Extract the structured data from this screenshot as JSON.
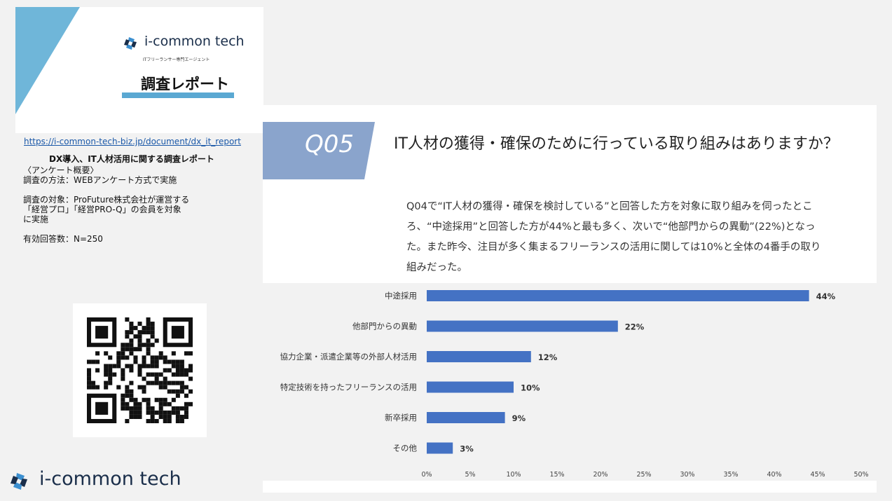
{
  "cover": {
    "logo_text": "i-common tech",
    "tagline": "ITフリーランサー専門エージェント",
    "title": "調査レポート"
  },
  "report": {
    "url": "https://i-common-tech-biz.jp/document/dx_it_report",
    "title": "DX導入、IT人材活用に関する調査レポート",
    "info": [
      "〈アンケート概要〉",
      "調査の方法：WEBアンケート方式で実施",
      "",
      "調査の対象：ProFuture株式会社が運営する\n「経営プロ」「経営PRO-Q」の会員を対象\nに実施",
      "",
      "有効回答数：N=250"
    ]
  },
  "footer": {
    "logo_text": "i-common tech"
  },
  "slide": {
    "q_number": "Q05",
    "question": "IT人材の獲得・確保のために行っている取り組みはありますか？",
    "summary": "Q04で“IT人材の獲得・確保を検討している”と回答した方を対象に取り組みを伺ったところ、“中途採用”と回答した方が44%と最も多く、次いで“他部門からの異動”(22%)となった。また昨今、注目が多く集まるフリーランスの活用に関しては10%と全体の4番手の取り組みだった。"
  },
  "colors": {
    "bar": "#4472c4",
    "q_band": "#8aa4cc",
    "accent_blue": "#6fb6d9",
    "brand_dark": "#1a2e4a"
  },
  "icons": {
    "logo": "i-common-tech-logo-icon",
    "qr": "qr-code"
  },
  "chart_data": {
    "type": "bar",
    "orientation": "horizontal",
    "categories": [
      "中途採用",
      "他部門からの異動",
      "協力企業・派遣企業等の外部人材活用",
      "特定技術を持ったフリーランスの活用",
      "新卒採用",
      "その他"
    ],
    "values": [
      44,
      22,
      12,
      10,
      9,
      3
    ],
    "value_labels": [
      "44%",
      "22%",
      "12%",
      "10%",
      "9%",
      "3%"
    ],
    "x_ticks": [
      "0%",
      "5%",
      "10%",
      "15%",
      "20%",
      "25%",
      "30%",
      "35%",
      "40%",
      "45%",
      "50%"
    ],
    "xlim": [
      0,
      50
    ],
    "grid": false,
    "legend": false
  }
}
